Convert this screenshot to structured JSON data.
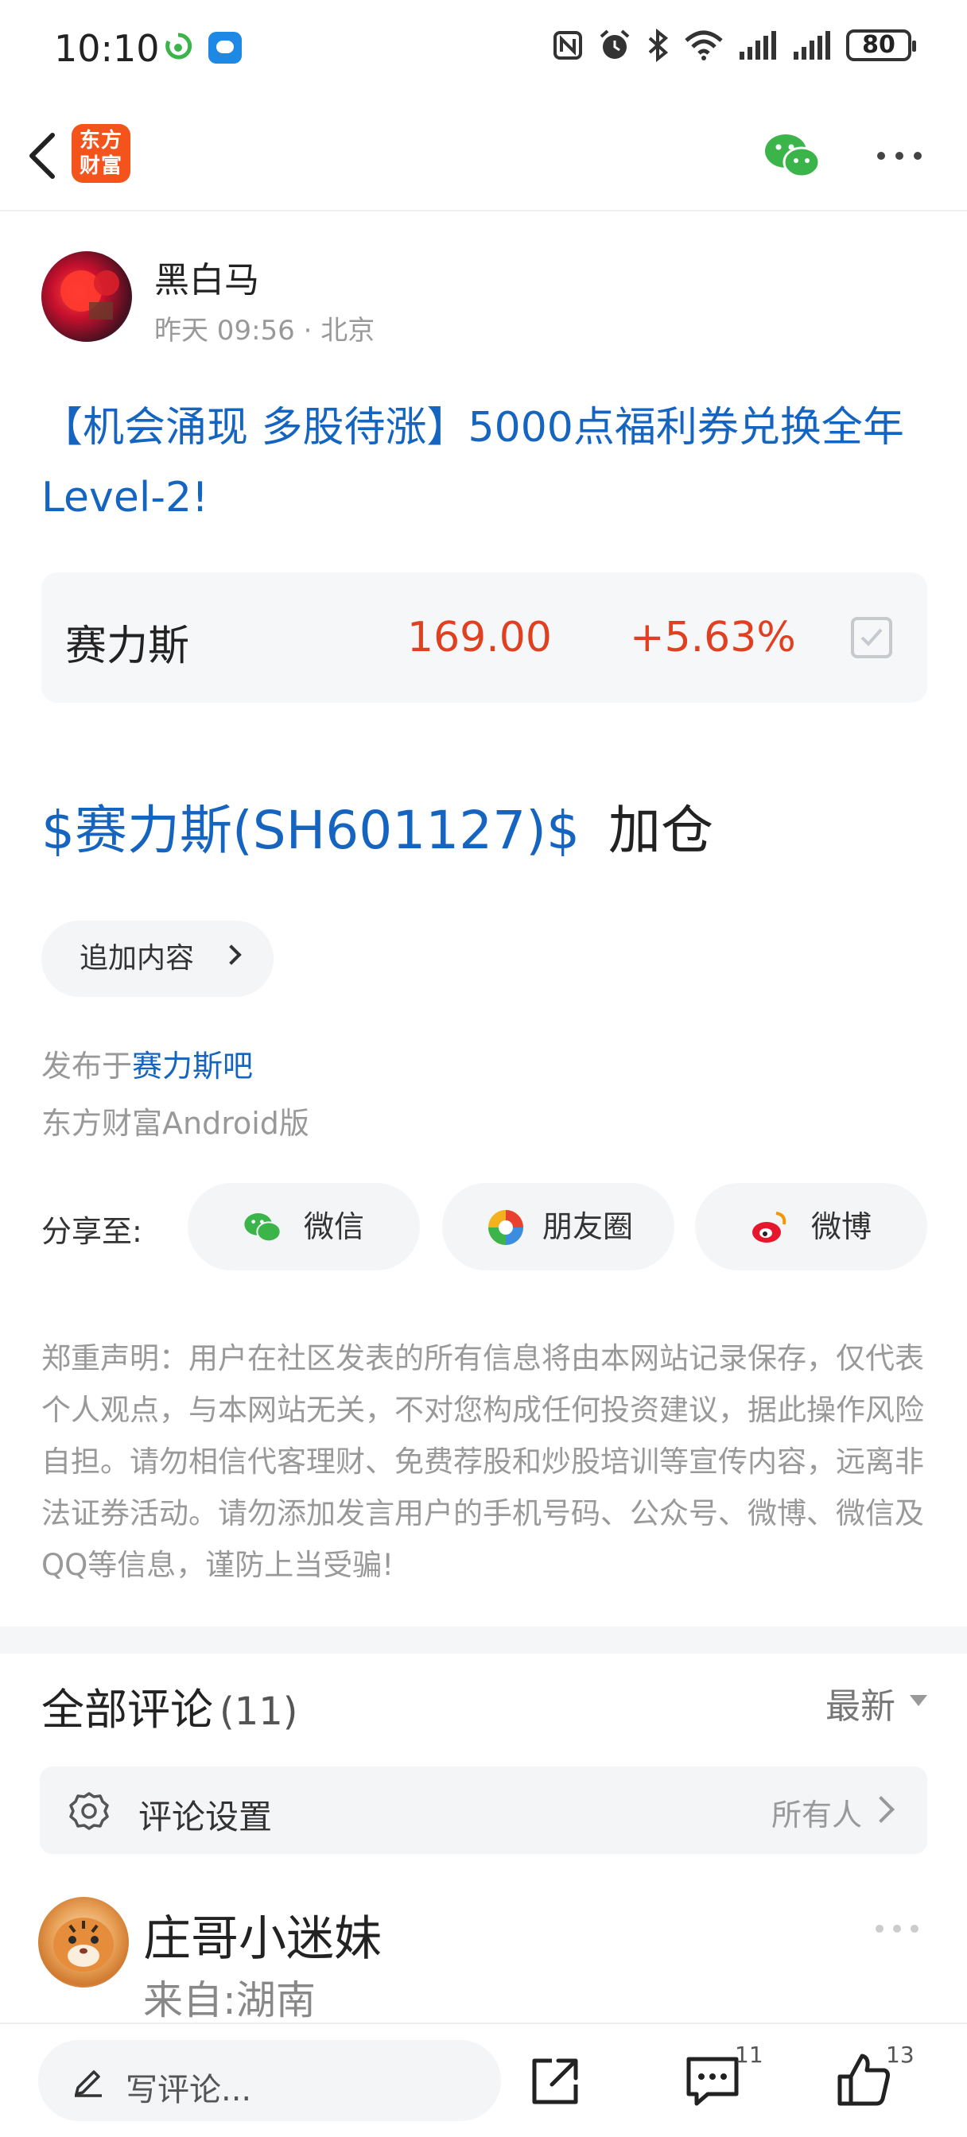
{
  "status_bar": {
    "time": "10:10",
    "battery": "80",
    "icons": [
      "nfc-icon",
      "alarm-icon",
      "bluetooth-icon",
      "wifi-icon",
      "signal-icon",
      "signal-icon",
      "battery-icon"
    ]
  },
  "nav": {
    "logo_text_top": "东方",
    "logo_text_bottom": "财富",
    "logo_color": "#f4531c"
  },
  "post": {
    "author": "黑白马",
    "meta": "昨天 09:56 · 北京",
    "title": "【机会涌现 多股待涨】5000点福利券兑换全年Level-2!",
    "stock": {
      "name": "赛力斯",
      "price": "169.00",
      "change": "+5.63%"
    },
    "body_tag": "$赛力斯(SH601127)$",
    "body_text": "加仓",
    "append_label": "追加内容",
    "published_prefix": "发布于",
    "published_bar": "赛力斯吧",
    "client": "东方财富Android版"
  },
  "share": {
    "label": "分享至:",
    "items": [
      "微信",
      "朋友圈",
      "微博"
    ]
  },
  "disclaimer": "郑重声明：用户在社区发表的所有信息将由本网站记录保存，仅代表个人观点，与本网站无关，不对您构成任何投资建议，据此操作风险自担。请勿相信代客理财、免费荐股和炒股培训等宣传内容，远离非法证券活动。请勿添加发言用户的手机号码、公众号、微博、微信及QQ等信息，谨防上当受骗!",
  "comments": {
    "title": "全部评论",
    "count": "(11)",
    "sort": "最新",
    "settings_label": "评论设置",
    "settings_value": "所有人",
    "first_user": "庄哥小迷妹",
    "first_region": "来自:湖南"
  },
  "bottom_bar": {
    "placeholder": "写评论...",
    "comment_count": "11",
    "like_count": "13"
  },
  "colors": {
    "link_blue": "#1565c0",
    "price_red": "#e0401f",
    "wechat_green": "#3bb44a"
  }
}
